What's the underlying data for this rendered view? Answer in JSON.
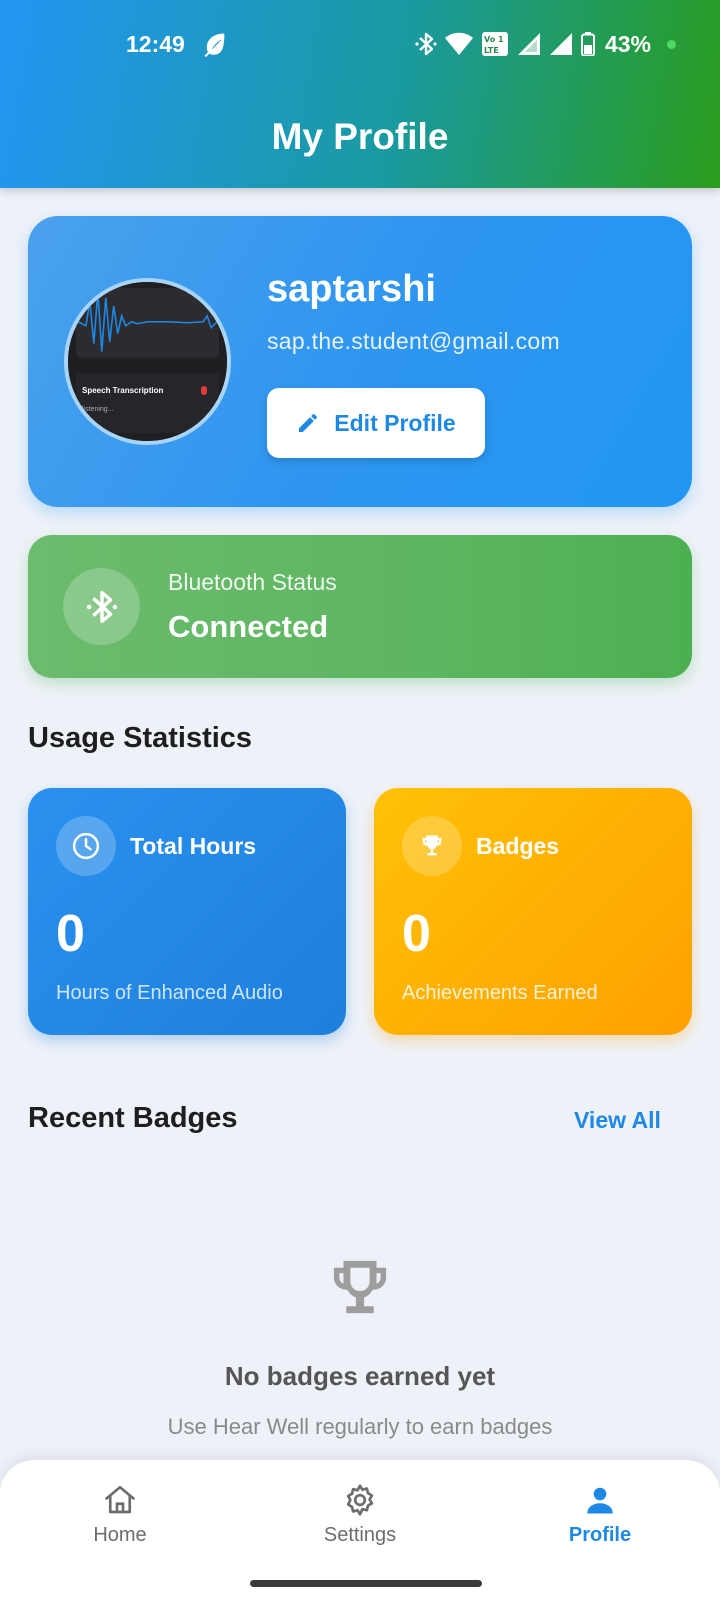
{
  "status_bar": {
    "time": "12:49",
    "battery": "43%",
    "icons": [
      "leaf-icon",
      "bluetooth-icon",
      "wifi-icon",
      "volte-icon",
      "signal-icon",
      "signal-icon",
      "battery-icon"
    ]
  },
  "header": {
    "title": "My Profile"
  },
  "profile": {
    "name": "saptarshi",
    "email": "sap.the.student@gmail.com",
    "edit_label": "Edit Profile",
    "avatar_caption": "Speech Transcription",
    "avatar_sub": "listening..."
  },
  "bluetooth": {
    "label": "Bluetooth Status",
    "value": "Connected"
  },
  "usage": {
    "title": "Usage Statistics",
    "hours": {
      "label": "Total Hours",
      "value": "0",
      "sub": "Hours of Enhanced Audio"
    },
    "badges": {
      "label": "Badges",
      "value": "0",
      "sub": "Achievements Earned"
    }
  },
  "recent": {
    "title": "Recent Badges",
    "view_all": "View All",
    "empty_title": "No badges earned yet",
    "empty_sub": "Use Hear Well regularly to earn badges"
  },
  "nav": {
    "home": "Home",
    "settings": "Settings",
    "profile": "Profile",
    "active": "profile"
  },
  "colors": {
    "accent_blue": "#1e88e5",
    "success_green": "#4caf50",
    "badge_orange": "#ffa000"
  }
}
